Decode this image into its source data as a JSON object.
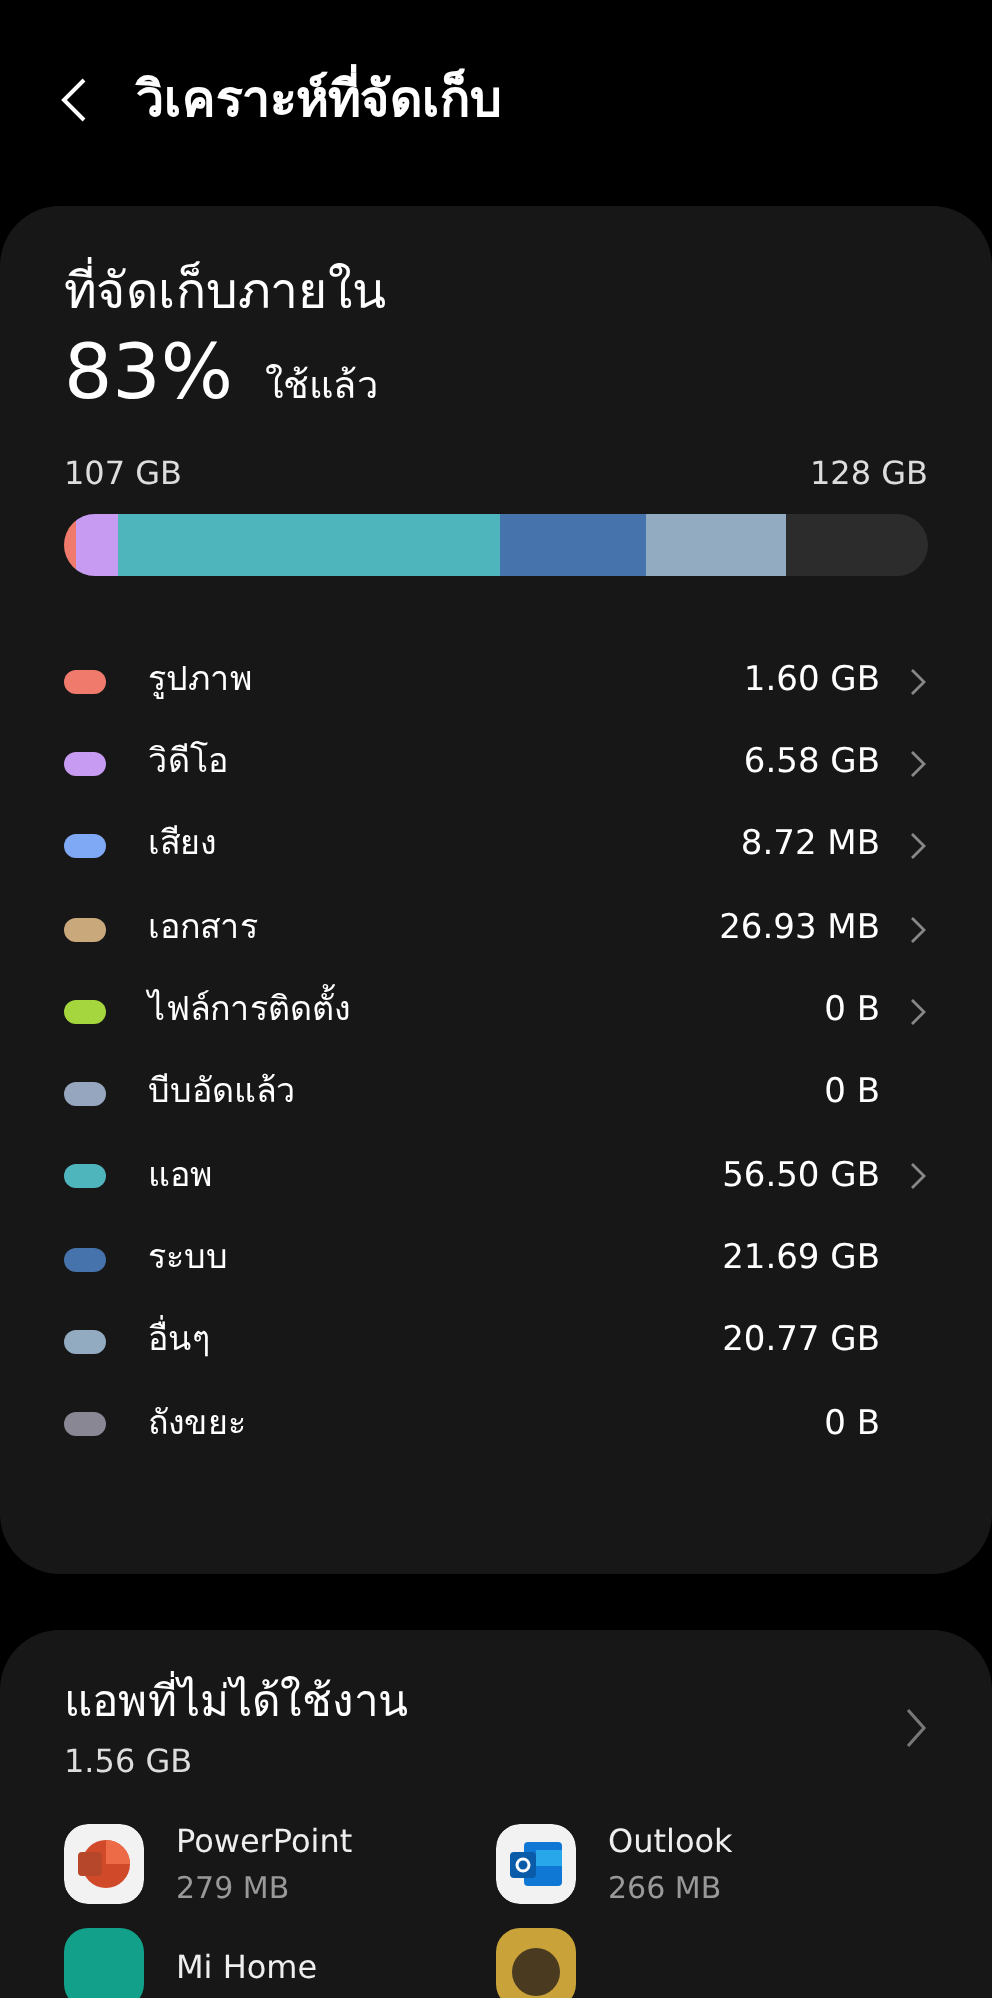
{
  "header": {
    "title": "วิเคราะห์ที่จัดเก็บ"
  },
  "storage": {
    "title": "ที่จัดเก็บภายใน",
    "percent": "83%",
    "used_label": "ใช้แล้ว",
    "used": "107 GB",
    "total": "128 GB",
    "bar": [
      {
        "color": "#f07b6c"
      },
      {
        "color": "#c79bf2"
      },
      {
        "color": "#4fb5bd"
      },
      {
        "color": "#4673ab"
      },
      {
        "color": "#93abc0"
      }
    ],
    "categories": [
      {
        "name": "รูปภาพ",
        "size": "1.60 GB",
        "color": "#f07b6c",
        "chevron": true
      },
      {
        "name": "วิดีโอ",
        "size": "6.58 GB",
        "color": "#c79bf2",
        "chevron": true
      },
      {
        "name": "เสียง",
        "size": "8.72 MB",
        "color": "#7fa9f5",
        "chevron": true
      },
      {
        "name": "เอกสาร",
        "size": "26.93 MB",
        "color": "#c9a97c",
        "chevron": true
      },
      {
        "name": "ไฟล์การติดตั้ง",
        "size": "0 B",
        "color": "#a6d63e",
        "chevron": true
      },
      {
        "name": "บีบอัดแล้ว",
        "size": "0 B",
        "color": "#96a6bf",
        "chevron": false
      },
      {
        "name": "แอพ",
        "size": "56.50 GB",
        "color": "#4fb5bd",
        "chevron": true
      },
      {
        "name": "ระบบ",
        "size": "21.69 GB",
        "color": "#4673ab",
        "chevron": false
      },
      {
        "name": "อื่นๆ",
        "size": "20.77 GB",
        "color": "#93abc0",
        "chevron": false
      },
      {
        "name": "ถังขยะ",
        "size": "0 B",
        "color": "#8a8794",
        "chevron": false
      }
    ]
  },
  "unused_apps": {
    "title": "แอพที่ไม่ได้ใช้งาน",
    "size": "1.56 GB",
    "apps": [
      {
        "kind": "app",
        "name": "PowerPoint",
        "size": "279 MB"
      },
      {
        "kind": "app",
        "name": "Outlook",
        "size": "266 MB"
      },
      {
        "kind": "app",
        "name": "Mi Home"
      },
      {
        "kind": "app"
      }
    ]
  }
}
